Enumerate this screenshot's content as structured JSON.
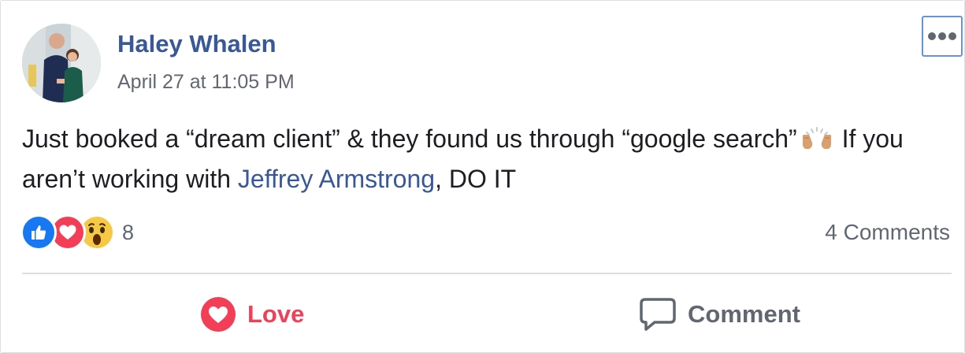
{
  "post": {
    "author": "Haley Whalen",
    "timestamp": "April 27 at 11:05 PM",
    "text_before_emoji": "Just booked a “dream client” & they found us through “google search”",
    "emoji": "raised-hands-emoji",
    "text_after_emoji": " If you aren’t working with ",
    "mention": "Jeffrey Armstrong",
    "text_end": ", DO IT"
  },
  "reactions": {
    "types": [
      "like",
      "love",
      "wow"
    ],
    "count": "8"
  },
  "comments_count": "4 Comments",
  "actions": {
    "love_label": "Love",
    "comment_label": "Comment"
  },
  "icons": {
    "menu": "more-options-icon",
    "love_action": "heart-icon",
    "comment_action": "speech-bubble-icon"
  },
  "colors": {
    "link": "#385898",
    "love": "#f33e58",
    "like": "#1877f2",
    "wow": "#f7c846",
    "muted": "#616770"
  }
}
